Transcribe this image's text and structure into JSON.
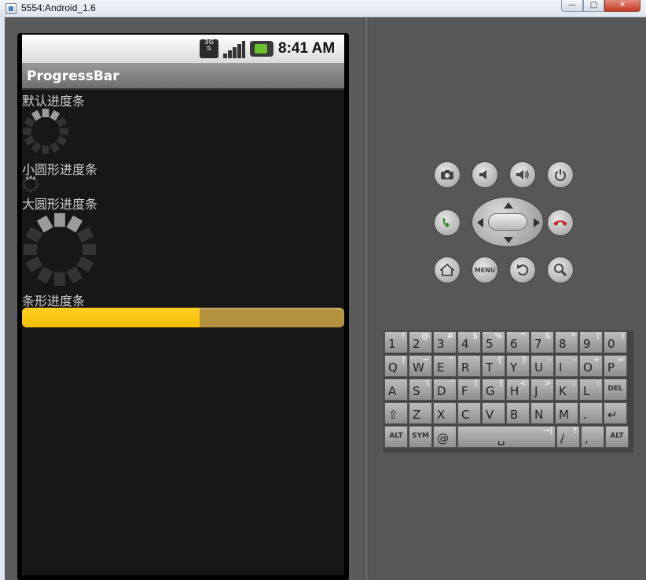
{
  "window": {
    "title": "5554:Android_1.6",
    "min": "—",
    "max": "□",
    "close": "✕"
  },
  "status_bar": {
    "network": "3G",
    "time": "8:41 AM"
  },
  "app": {
    "title": "ProgressBar"
  },
  "labels": {
    "default_progress": "默认进度条",
    "small_circle": "小圆形进度条",
    "large_circle": "大圆形进度条",
    "horizontal": "条形进度条"
  },
  "progress": {
    "horizontal_value": 0.55
  },
  "colors": {
    "bar_fill": "#ffc700",
    "bar_track": "#b2923e",
    "spinner_light": "#9b9b9b",
    "spinner_dark": "#333333"
  },
  "controls": {
    "camera": "camera-icon",
    "vol_down": "volume-down-icon",
    "vol_up": "volume-up-icon",
    "power": "power-icon",
    "call": "call-icon",
    "end_call": "end-call-icon",
    "home": "home-icon",
    "menu": "MENU",
    "back": "back-icon",
    "search": "search-icon"
  },
  "keyboard": {
    "row1": [
      [
        "1",
        "!"
      ],
      [
        "2",
        "@"
      ],
      [
        "3",
        "#"
      ],
      [
        "4",
        "$"
      ],
      [
        "5",
        "%"
      ],
      [
        "6",
        "^"
      ],
      [
        "7",
        "&"
      ],
      [
        "8",
        "*"
      ],
      [
        "9",
        "("
      ],
      [
        "0",
        ")"
      ]
    ],
    "row2": [
      [
        "Q",
        "|"
      ],
      [
        "W",
        "~"
      ],
      [
        "E",
        "\""
      ],
      [
        "R",
        "`"
      ],
      [
        "T",
        "{"
      ],
      [
        "Y",
        "}"
      ],
      [
        "U",
        "-"
      ],
      [
        "I",
        "-"
      ],
      [
        "O",
        "+"
      ],
      [
        "P",
        "="
      ]
    ],
    "row3": [
      [
        "A",
        ""
      ],
      [
        "S",
        "\\"
      ],
      [
        "D",
        "'"
      ],
      [
        "F",
        "["
      ],
      [
        "G",
        "]"
      ],
      [
        "H",
        "<"
      ],
      [
        "J",
        ">"
      ],
      [
        "K",
        ";"
      ],
      [
        "L",
        ":"
      ],
      [
        "DEL",
        ""
      ]
    ],
    "row4": [
      [
        "⇧",
        ""
      ],
      [
        "Z",
        ""
      ],
      [
        "X",
        ""
      ],
      [
        "C",
        ""
      ],
      [
        "V",
        ""
      ],
      [
        "B",
        ""
      ],
      [
        "N",
        ""
      ],
      [
        "M",
        ""
      ],
      [
        ".",
        ""
      ],
      [
        "↵",
        ""
      ]
    ],
    "row5": [
      [
        "ALT",
        ""
      ],
      [
        "SYM",
        ""
      ],
      [
        "@",
        ""
      ],
      [
        "␣",
        "→|"
      ],
      [
        "/",
        "?"
      ],
      [
        ",",
        ""
      ],
      [
        "ALT",
        ""
      ]
    ]
  }
}
